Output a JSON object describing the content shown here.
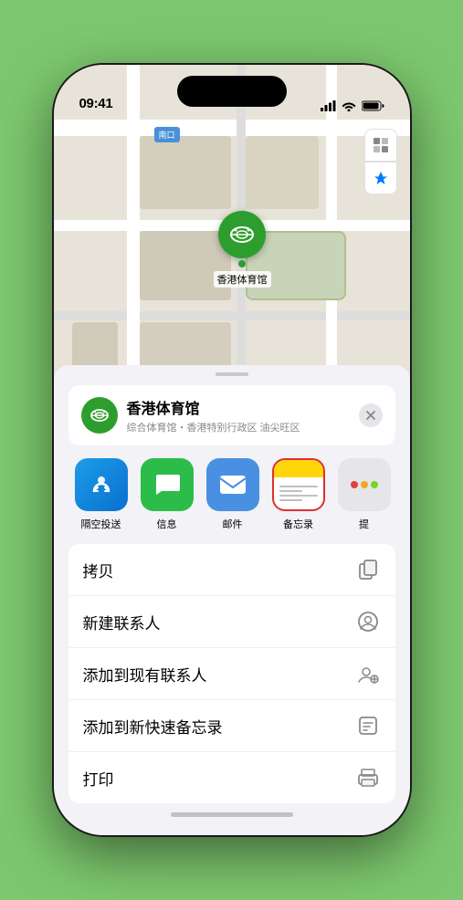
{
  "status_bar": {
    "time": "09:41",
    "signal_bars": "signal-icon",
    "wifi": "wifi-icon",
    "battery": "battery-icon"
  },
  "map": {
    "label_text": "南口",
    "controls": [
      "map-type-icon",
      "location-arrow-icon"
    ],
    "pin_label": "香港体育馆"
  },
  "location_card": {
    "name": "香港体育馆",
    "subtitle": "综合体育馆・香港特别行政区 油尖旺区",
    "close_label": "×"
  },
  "share_items": [
    {
      "id": "airdrop",
      "label": "隔空投送"
    },
    {
      "id": "message",
      "label": "信息"
    },
    {
      "id": "mail",
      "label": "邮件"
    },
    {
      "id": "notes",
      "label": "备忘录"
    },
    {
      "id": "more",
      "label": "提"
    }
  ],
  "menu_items": [
    {
      "label": "拷贝",
      "icon": "copy-icon"
    },
    {
      "label": "新建联系人",
      "icon": "new-contact-icon"
    },
    {
      "label": "添加到现有联系人",
      "icon": "add-contact-icon"
    },
    {
      "label": "添加到新快速备忘录",
      "icon": "quick-note-icon"
    },
    {
      "label": "打印",
      "icon": "print-icon"
    }
  ]
}
